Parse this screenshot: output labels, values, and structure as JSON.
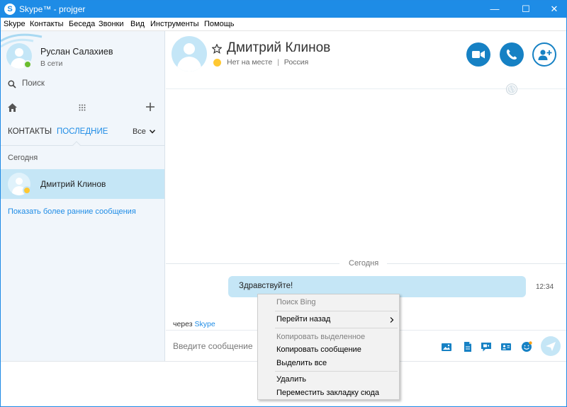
{
  "window": {
    "title": "Skype™ - projger",
    "icon_letter": "S",
    "minimize_glyph": "—",
    "maximize_glyph": "☐",
    "close_glyph": "✕",
    "accent_color": "#1e8ce6"
  },
  "menu": {
    "items": [
      "Skype",
      "Контакты",
      "Беседа",
      "Звонки",
      "Вид",
      "Инструменты",
      "Помощь"
    ]
  },
  "sidebar": {
    "user_name": "Руслан Салахиев",
    "user_status": "В сети",
    "search_placeholder": "Поиск",
    "tab_contacts": "КОНТАКТЫ",
    "tab_recent": "ПОСЛЕДНИЕ",
    "filter_label": "Все",
    "section_today": "Сегодня",
    "contact_name": "Дмитрий Клинов",
    "show_more": "Показать более ранние сообщения"
  },
  "chat": {
    "name": "Дмитрий Клинов",
    "status": "Нет на месте",
    "location": "Россия",
    "separator": "|",
    "today_label": "Сегодня",
    "message_text": "Здравствуйте!",
    "message_time": "12:34",
    "via_prefix": "через",
    "via_link": "Skype",
    "input_placeholder": "Введите сообщение"
  },
  "context_menu": {
    "items": [
      {
        "label": "Поиск Bing",
        "enabled": false
      },
      {
        "label": "Перейти назад",
        "enabled": true,
        "submenu": true
      },
      {
        "label": "Копировать выделенное",
        "enabled": false
      },
      {
        "label": "Копировать сообщение",
        "enabled": true
      },
      {
        "label": "Выделить все",
        "enabled": true
      },
      {
        "label": "Удалить",
        "enabled": true
      },
      {
        "label": "Переместить закладку сюда",
        "enabled": true
      }
    ]
  }
}
